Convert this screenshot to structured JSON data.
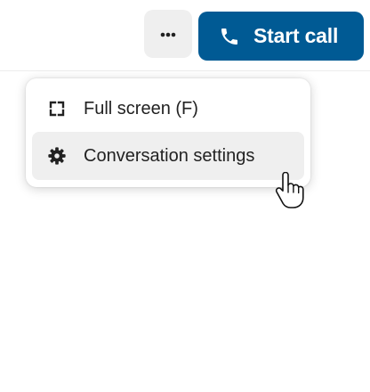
{
  "header": {
    "more_icon": "more-horizontal-icon",
    "start_call": {
      "icon": "phone-icon",
      "label": "Start call",
      "color": "#005a94"
    }
  },
  "menu": {
    "items": [
      {
        "icon": "fullscreen-icon",
        "label": "Full screen (F)",
        "highlighted": false
      },
      {
        "icon": "gear-icon",
        "label": "Conversation settings",
        "highlighted": true
      }
    ]
  },
  "cursor": {
    "icon": "hand-pointer-icon"
  }
}
